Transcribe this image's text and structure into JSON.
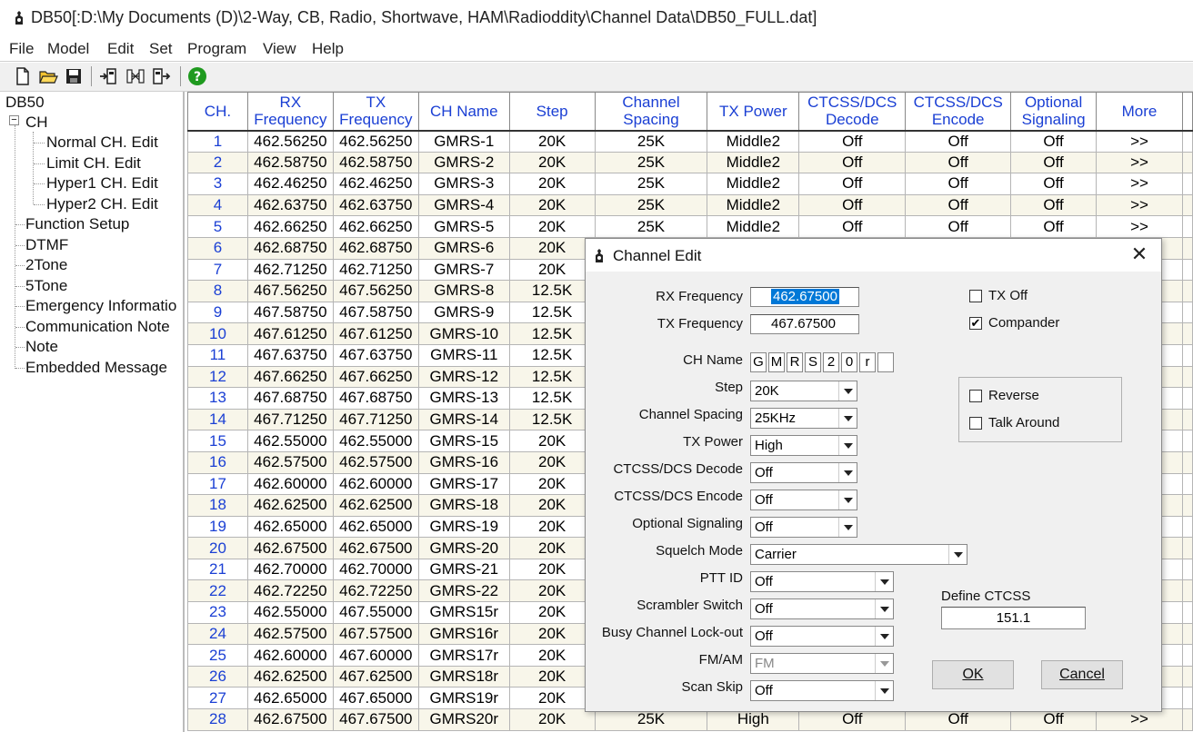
{
  "window": {
    "title": "DB50[:D:\\My Documents (D)\\2-Way, CB, Radio, Shortwave, HAM\\Radioddity\\Channel Data\\DB50_FULL.dat]"
  },
  "menu": [
    "File",
    "Model",
    "Edit",
    "Set",
    "Program",
    "View",
    "Help"
  ],
  "toolbar": {
    "icons": [
      "new-file-icon",
      "open-folder-icon",
      "save-icon",
      "read-radio-icon",
      "channel-map-icon",
      "write-radio-icon",
      "help-icon"
    ]
  },
  "tree": {
    "root": "DB50",
    "ch": "CH",
    "ch_children": [
      "Normal CH. Edit",
      "Limit CH. Edit",
      "Hyper1 CH. Edit",
      "Hyper2 CH. Edit"
    ],
    "items": [
      "Function Setup",
      "DTMF",
      "2Tone",
      "5Tone",
      "Emergency Informatio",
      "Communication Note",
      "Note",
      "Embedded Message"
    ]
  },
  "table": {
    "headers": [
      "CH.",
      "RX Frequency",
      "TX Frequency",
      "CH Name",
      "Step",
      "Channel Spacing",
      "TX Power",
      "CTCSS/DCS Decode",
      "CTCSS/DCS Encode",
      "Optional Signaling",
      "More"
    ],
    "rows": [
      [
        "1",
        "462.56250",
        "462.56250",
        "GMRS-1",
        "20K",
        "25K",
        "Middle2",
        "Off",
        "Off",
        "Off",
        ">>"
      ],
      [
        "2",
        "462.58750",
        "462.58750",
        "GMRS-2",
        "20K",
        "25K",
        "Middle2",
        "Off",
        "Off",
        "Off",
        ">>"
      ],
      [
        "3",
        "462.46250",
        "462.46250",
        "GMRS-3",
        "20K",
        "25K",
        "Middle2",
        "Off",
        "Off",
        "Off",
        ">>"
      ],
      [
        "4",
        "462.63750",
        "462.63750",
        "GMRS-4",
        "20K",
        "25K",
        "Middle2",
        "Off",
        "Off",
        "Off",
        ">>"
      ],
      [
        "5",
        "462.66250",
        "462.66250",
        "GMRS-5",
        "20K",
        "25K",
        "Middle2",
        "Off",
        "Off",
        "Off",
        ">>"
      ],
      [
        "6",
        "462.68750",
        "462.68750",
        "GMRS-6",
        "20K",
        "",
        "",
        "",
        "",
        "",
        ""
      ],
      [
        "7",
        "462.71250",
        "462.71250",
        "GMRS-7",
        "20K",
        "",
        "",
        "",
        "",
        "",
        ""
      ],
      [
        "8",
        "467.56250",
        "467.56250",
        "GMRS-8",
        "12.5K",
        "",
        "",
        "",
        "",
        "",
        ""
      ],
      [
        "9",
        "467.58750",
        "467.58750",
        "GMRS-9",
        "12.5K",
        "",
        "",
        "",
        "",
        "",
        ""
      ],
      [
        "10",
        "467.61250",
        "467.61250",
        "GMRS-10",
        "12.5K",
        "",
        "",
        "",
        "",
        "",
        ""
      ],
      [
        "11",
        "467.63750",
        "467.63750",
        "GMRS-11",
        "12.5K",
        "",
        "",
        "",
        "",
        "",
        ""
      ],
      [
        "12",
        "467.66250",
        "467.66250",
        "GMRS-12",
        "12.5K",
        "",
        "",
        "",
        "",
        "",
        ""
      ],
      [
        "13",
        "467.68750",
        "467.68750",
        "GMRS-13",
        "12.5K",
        "",
        "",
        "",
        "",
        "",
        ""
      ],
      [
        "14",
        "467.71250",
        "467.71250",
        "GMRS-14",
        "12.5K",
        "",
        "",
        "",
        "",
        "",
        ""
      ],
      [
        "15",
        "462.55000",
        "462.55000",
        "GMRS-15",
        "20K",
        "",
        "",
        "",
        "",
        "",
        ""
      ],
      [
        "16",
        "462.57500",
        "462.57500",
        "GMRS-16",
        "20K",
        "",
        "",
        "",
        "",
        "",
        ""
      ],
      [
        "17",
        "462.60000",
        "462.60000",
        "GMRS-17",
        "20K",
        "",
        "",
        "",
        "",
        "",
        ""
      ],
      [
        "18",
        "462.62500",
        "462.62500",
        "GMRS-18",
        "20K",
        "",
        "",
        "",
        "",
        "",
        ""
      ],
      [
        "19",
        "462.65000",
        "462.65000",
        "GMRS-19",
        "20K",
        "",
        "",
        "",
        "",
        "",
        ""
      ],
      [
        "20",
        "462.67500",
        "462.67500",
        "GMRS-20",
        "20K",
        "",
        "",
        "",
        "",
        "",
        ""
      ],
      [
        "21",
        "462.70000",
        "462.70000",
        "GMRS-21",
        "20K",
        "",
        "",
        "",
        "",
        "",
        ""
      ],
      [
        "22",
        "462.72250",
        "462.72250",
        "GMRS-22",
        "20K",
        "",
        "",
        "",
        "",
        "",
        ""
      ],
      [
        "23",
        "462.55000",
        "467.55000",
        "GMRS15r",
        "20K",
        "",
        "",
        "",
        "",
        "",
        ""
      ],
      [
        "24",
        "462.57500",
        "467.57500",
        "GMRS16r",
        "20K",
        "",
        "",
        "",
        "",
        "",
        ""
      ],
      [
        "25",
        "462.60000",
        "467.60000",
        "GMRS17r",
        "20K",
        "",
        "",
        "",
        "",
        "",
        ""
      ],
      [
        "26",
        "462.62500",
        "467.62500",
        "GMRS18r",
        "20K",
        "",
        "",
        "",
        "",
        "",
        ""
      ],
      [
        "27",
        "462.65000",
        "467.65000",
        "GMRS19r",
        "20K",
        "",
        "",
        "",
        "",
        "",
        ""
      ],
      [
        "28",
        "462.67500",
        "467.67500",
        "GMRS20r",
        "20K",
        "25K",
        "High",
        "Off",
        "Off",
        "Off",
        ">>"
      ]
    ]
  },
  "dialog": {
    "title": "Channel Edit",
    "rx_label": "RX Frequency",
    "rx_value": "462.67500",
    "tx_label": "TX Frequency",
    "tx_value": "467.67500",
    "chname_label": "CH Name",
    "chname_chars": [
      "G",
      "M",
      "R",
      "S",
      "2",
      "0",
      "r",
      ""
    ],
    "step_label": "Step",
    "step_value": "20K",
    "spacing_label": "Channel Spacing",
    "spacing_value": "25KHz",
    "power_label": "TX Power",
    "power_value": "High",
    "decode_label": "CTCSS/DCS Decode",
    "decode_value": "Off",
    "encode_label": "CTCSS/DCS Encode",
    "encode_value": "Off",
    "optsig_label": "Optional Signaling",
    "optsig_value": "Off",
    "squelch_label": "Squelch Mode",
    "squelch_value": "Carrier",
    "pttid_label": "PTT ID",
    "pttid_value": "Off",
    "scrambler_label": "Scrambler Switch",
    "scrambler_value": "Off",
    "busy_label": "Busy Channel Lock-out",
    "busy_value": "Off",
    "fmam_label": "FM/AM",
    "fmam_value": "FM",
    "scanskip_label": "Scan Skip",
    "scanskip_value": "Off",
    "txoff_label": "TX Off",
    "txoff_checked": false,
    "compander_label": "Compander",
    "compander_checked": true,
    "reverse_label": "Reverse",
    "reverse_checked": false,
    "talkaround_label": "Talk Around",
    "talkaround_checked": false,
    "define_ctcss_label": "Define CTCSS",
    "define_ctcss_value": "151.1",
    "ok_label": "OK",
    "cancel_label": "Cancel",
    "checkmark": "✔",
    "close_glyph": "✕"
  },
  "colors": {
    "accent": "#1a3fd4",
    "row_alt": "#f8f6ea",
    "highlight": "#0078d7"
  }
}
